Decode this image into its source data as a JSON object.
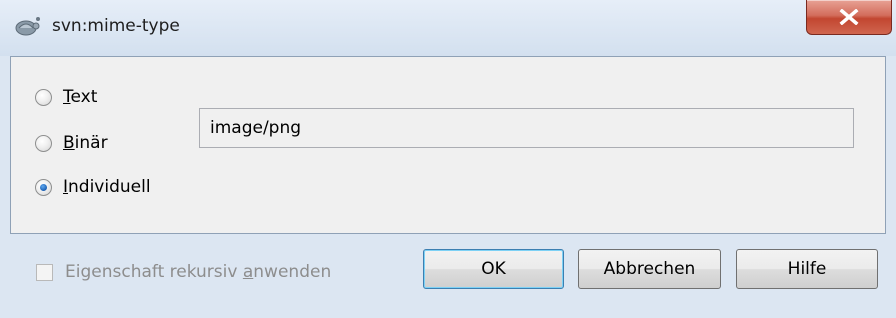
{
  "window": {
    "title": "svn:mime-type",
    "close_icon": "close-x-icon",
    "app_icon": "tortoisesvn-icon"
  },
  "options": [
    {
      "id": "text",
      "accel": "T",
      "rest": "ext",
      "checked": false
    },
    {
      "id": "binary",
      "accel": "B",
      "rest": "inär",
      "checked": false
    },
    {
      "id": "custom",
      "accel": "I",
      "rest": "ndividuell",
      "checked": true
    }
  ],
  "mime_input": {
    "value": "image/png"
  },
  "recursive": {
    "pre": "Eigenschaft rekursiv ",
    "accel": "a",
    "post": "nwenden",
    "checked": false,
    "enabled": false
  },
  "buttons": {
    "ok": "OK",
    "cancel": "Abbrechen",
    "help": "Hilfe"
  }
}
